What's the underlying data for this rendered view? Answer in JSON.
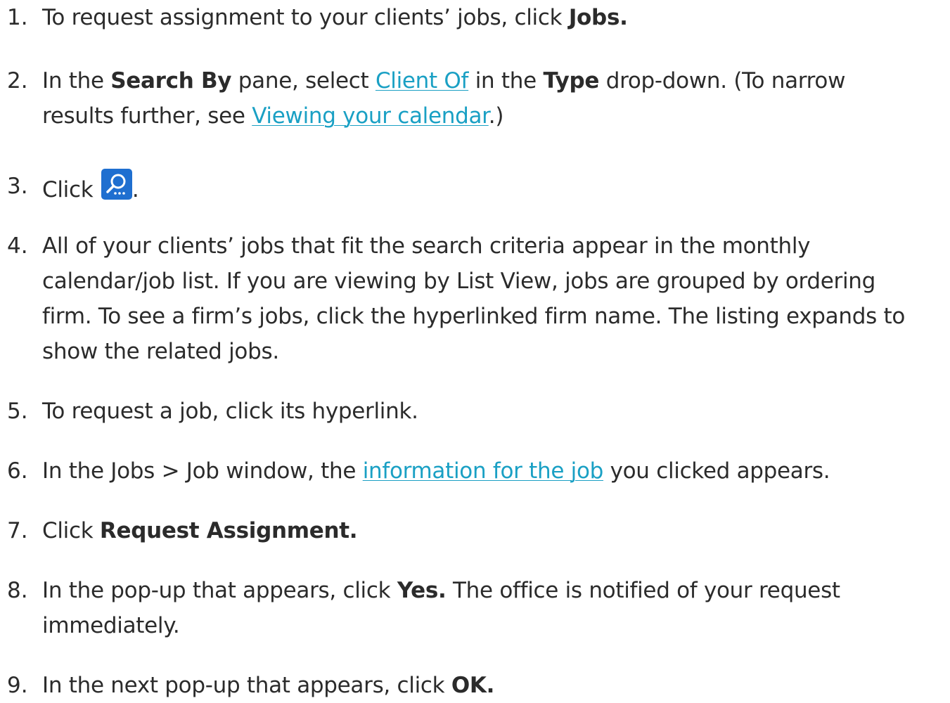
{
  "steps": [
    {
      "num": "1.",
      "parts": [
        {
          "t": "To request assignment to your clients’ jobs, click "
        },
        {
          "t": "Jobs.",
          "b": true
        }
      ]
    },
    {
      "num": "2.",
      "parts": [
        {
          "t": "In the "
        },
        {
          "t": "Search By",
          "b": true
        },
        {
          "t": " pane, select "
        },
        {
          "t": "Client Of",
          "link": true
        },
        {
          "t": " in the "
        },
        {
          "t": "Type",
          "b": true
        },
        {
          "t": " drop-down. (To narrow"
        },
        {
          "br": true
        },
        {
          "t": "results further, see "
        },
        {
          "t": "Viewing your calendar",
          "link": true
        },
        {
          "t": ".)"
        }
      ]
    },
    {
      "num": "3.",
      "parts": [
        {
          "t": "Click "
        },
        {
          "icon": "search-icon"
        },
        {
          "t": "."
        }
      ]
    },
    {
      "num": "4.",
      "parts": [
        {
          "t": "All of your clients’ jobs that fit the search criteria appear in the monthly"
        },
        {
          "br": true
        },
        {
          "t": "calendar/job list. If you are viewing by List View, jobs are grouped by ordering"
        },
        {
          "br": true
        },
        {
          "t": "firm. To see a firm’s jobs, click the hyperlinked firm name. The listing expands to"
        },
        {
          "br": true
        },
        {
          "t": "show the related jobs."
        }
      ]
    },
    {
      "num": "5.",
      "parts": [
        {
          "t": "To request a job, click its hyperlink."
        }
      ]
    },
    {
      "num": "6.",
      "parts": [
        {
          "t": "In the Jobs > Job window, the "
        },
        {
          "t": "information for the job",
          "link": true
        },
        {
          "t": " you clicked appears."
        }
      ]
    },
    {
      "num": "7.",
      "parts": [
        {
          "t": "Click "
        },
        {
          "t": "Request Assignment.",
          "b": true
        }
      ]
    },
    {
      "num": "8.",
      "parts": [
        {
          "t": "In the pop-up that appears, click "
        },
        {
          "t": "Yes.",
          "b": true
        },
        {
          "t": " The office is notified of your request"
        },
        {
          "br": true
        },
        {
          "t": "immediately."
        }
      ]
    },
    {
      "num": "9.",
      "parts": [
        {
          "t": "In the next pop-up that appears, click "
        },
        {
          "t": "OK.",
          "b": true
        }
      ]
    }
  ],
  "colors": {
    "text": "#2b2b2b",
    "link": "#1aa0c4",
    "search_button": "#1f6fd0"
  }
}
